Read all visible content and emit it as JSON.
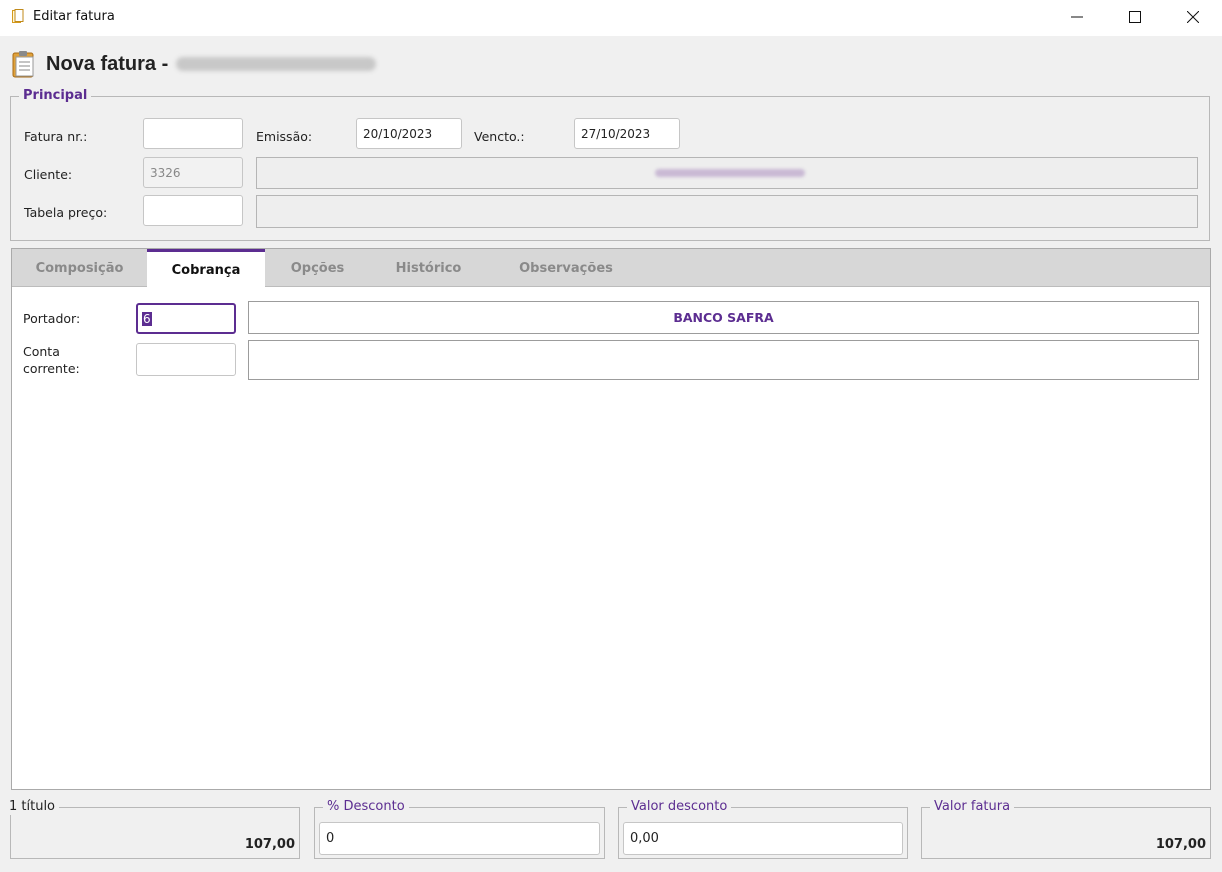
{
  "window": {
    "title": "Editar fatura"
  },
  "header": {
    "title": "Nova fatura -"
  },
  "principal": {
    "legend": "Principal",
    "fatura_label": "Fatura nr.:",
    "fatura_value": "",
    "emissao_label": "Emissão:",
    "emissao_value": "20/10/2023",
    "vencto_label": "Vencto.:",
    "vencto_value": "27/10/2023",
    "cliente_label": "Cliente:",
    "cliente_code": "3326",
    "tabela_label": "Tabela preço:",
    "tabela_value": ""
  },
  "tabs": [
    {
      "label": "Composição"
    },
    {
      "label": "Cobrança"
    },
    {
      "label": "Opções"
    },
    {
      "label": "Histórico"
    },
    {
      "label": "Observações"
    }
  ],
  "active_tab": "Cobrança",
  "cobranca": {
    "portador_label": "Portador:",
    "portador_value": "6",
    "portador_name": "BANCO SAFRA",
    "conta_label_1": "Conta",
    "conta_label_2": "corrente:",
    "conta_value": ""
  },
  "footer": {
    "titulos_legend": "1 título",
    "titulos_value": "107,00",
    "desconto_pct_legend": "% Desconto",
    "desconto_pct_value": "0",
    "valor_desconto_legend": "Valor desconto",
    "valor_desconto_value": "0,00",
    "valor_fatura_legend": "Valor fatura",
    "valor_fatura_value": "107,00"
  },
  "colors": {
    "accent": "#5c2d91"
  }
}
